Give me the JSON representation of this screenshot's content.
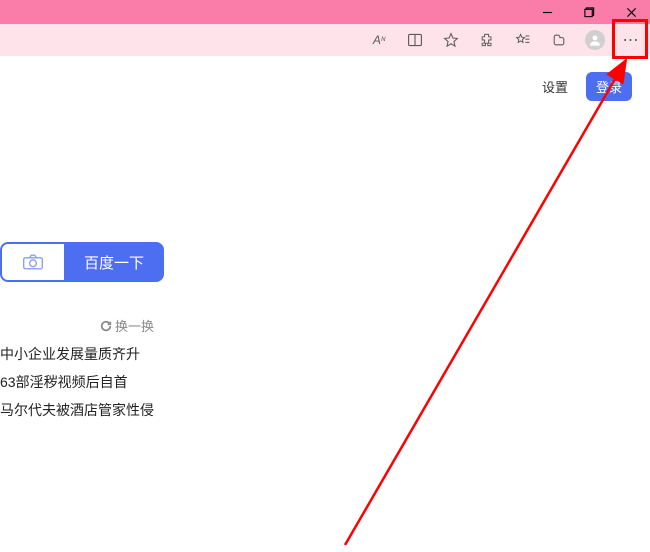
{
  "window": {
    "minimize": "—",
    "maximize": "❐",
    "close": "✕"
  },
  "toolbar": {
    "read_aloud": "Aあ",
    "more_dots": "⋯"
  },
  "page": {
    "settings_label": "设置",
    "login_label": "登录",
    "search_button_label": "百度一下",
    "refresh_label": "换一换"
  },
  "news": {
    "items": [
      "中小企业发展量质齐升",
      "63部淫秽视频后自首",
      "马尔代夫被酒店管家性侵"
    ]
  }
}
